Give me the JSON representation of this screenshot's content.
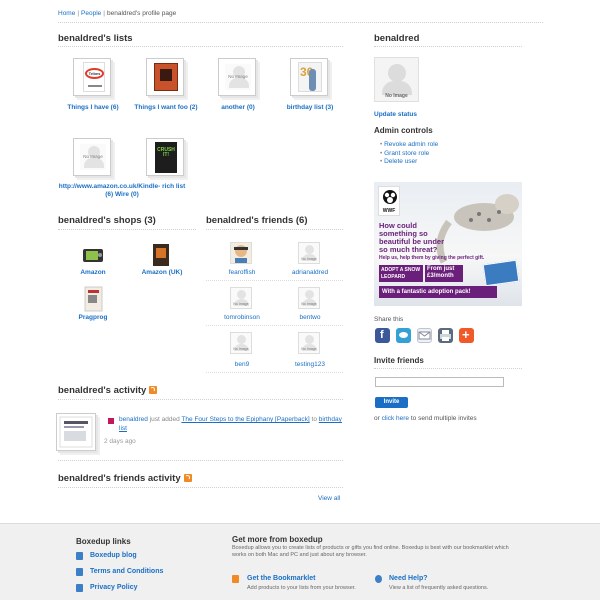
{
  "breadcrumb": {
    "home": "Home",
    "people": "People",
    "current": "benaldred's profile page"
  },
  "lists": {
    "title": "benaldred's lists",
    "items": [
      {
        "label": "Things I have (6)",
        "cover_text": "Tribes"
      },
      {
        "label": "Things I want foo (2)"
      },
      {
        "label": "another (0)",
        "placeholder": "No Image"
      },
      {
        "label": "birthday list (3)",
        "cover_text": "30"
      },
      {
        "label": "http://www.amazon.co.uk/Kindle- rich list (6) Wire (0)",
        "placeholder": "No Image"
      },
      {
        "label": "",
        "cover_text": "CRUSH IT!"
      }
    ]
  },
  "shops": {
    "title": "benaldred's shops (3)",
    "items": [
      {
        "label": "Amazon"
      },
      {
        "label": "Amazon (UK)"
      },
      {
        "label": "Pragprog"
      }
    ]
  },
  "friends": {
    "title": "benaldred's friends (6)",
    "placeholder": "No Image",
    "items": [
      {
        "name": "fearoffish"
      },
      {
        "name": "adrianaldred"
      },
      {
        "name": "tomrobinson"
      },
      {
        "name": "bentwo"
      },
      {
        "name": "ben9"
      },
      {
        "name": "testing123"
      }
    ]
  },
  "activity": {
    "title": "benaldred's activity",
    "user": "benaldred",
    "action": "just added",
    "item": "The Four Steps to the Epiphany [Paperback]",
    "preposition": "to",
    "list": "birthday list",
    "time": "2 days ago"
  },
  "friends_activity": {
    "title": "benaldred's friends activity",
    "view_all": "View all"
  },
  "sidebar": {
    "username": "benaldred",
    "avatar_placeholder": "No Image",
    "update_status": "Update status",
    "admin_title": "Admin controls",
    "admin_links": [
      "Revoke admin role",
      "Grant store role",
      "Delete user"
    ],
    "ad": {
      "brand": "WWF",
      "headline": "How could something so beautiful be under so much threat?",
      "subline": "Help us, help them by giving the perfect gift.",
      "cta": "ADOPT A SNOW LEOPARD",
      "price": "From just £3/month",
      "footer": "With a fantastic adoption pack!"
    },
    "share_title": "Share this",
    "invite_title": "Invite friends",
    "invite_button": "Invite",
    "invite_or": "or",
    "invite_link": "click here",
    "invite_rest": "to send multiple invites"
  },
  "footer": {
    "links_title": "Boxedup links",
    "links": [
      "Boxedup blog",
      "Terms and Conditions",
      "Privacy Policy"
    ],
    "more_title": "Get more from boxedup",
    "more_text": "Boxedup allows you to create lists of products or gifts you find online. Boxedup is best with our bookmarklet which works on both Mac and PC and just about any browser.",
    "bookmarklet_title": "Get the Bookmarklet",
    "bookmarklet_text": "Add products to your lists from your browser.",
    "help_title": "Need Help?",
    "help_text": "View a list of frequently asked questions."
  },
  "colors": {
    "link": "#1a6fc4",
    "rss": "#f08a24",
    "ad_purple": "#6a1f7a"
  }
}
